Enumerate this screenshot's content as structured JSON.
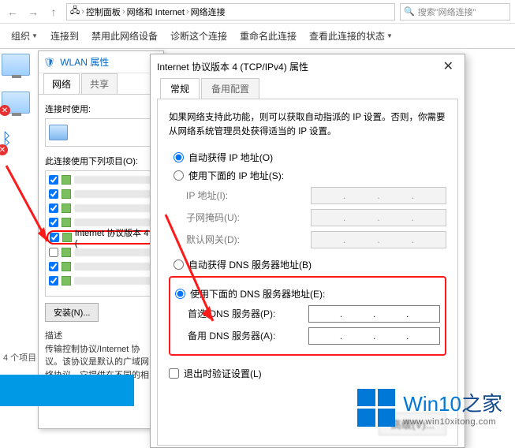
{
  "explorer": {
    "breadcrumb": [
      "",
      "控制面板",
      "网络和 Internet",
      "网络连接"
    ],
    "search_placeholder": "搜索\"网络连接\""
  },
  "commands": {
    "organize": "组织",
    "connect": "连接到",
    "disable": "禁用此网络设备",
    "diagnose": "诊断这个连接",
    "rename": "重命名此连接",
    "view_status": "查看此连接的状态"
  },
  "wlan_dialog": {
    "title": "WLAN 属性",
    "tabs": {
      "network": "网络",
      "share": "共享"
    },
    "connect_using": "连接时使用:",
    "items_label": "此连接使用下列项目(O):",
    "ipv4_item": "Internet 协议版本 4 (",
    "install_btn": "安装(N)...",
    "desc_title": "描述",
    "desc_text": "传输控制协议/Internet 协议。该协议是默认的广域网络协议，它提供在不同的相互连接的网络"
  },
  "ipv4_dialog": {
    "title": "Internet 协议版本 4 (TCP/IPv4) 属性",
    "tabs": {
      "general": "常规",
      "alt": "备用配置"
    },
    "description": "如果网络支持此功能，则可以获取自动指派的 IP 设置。否则，你需要从网络系统管理员处获得适当的 IP 设置。",
    "auto_ip": "自动获得 IP 地址(O)",
    "manual_ip": "使用下面的 IP 地址(S):",
    "ip_label": "IP 地址(I):",
    "mask_label": "子网掩码(U):",
    "gateway_label": "默认网关(D):",
    "auto_dns": "自动获得 DNS 服务器地址(B)",
    "manual_dns": "使用下面的 DNS 服务器地址(E):",
    "pref_dns": "首选 DNS 服务器(P):",
    "alt_dns": "备用 DNS 服务器(A):",
    "validate": "退出时验证设置(L)",
    "advanced": "高级(V)..."
  },
  "status": {
    "items_count": "4 个项目"
  },
  "watermark": {
    "brand1": "Win10",
    "brand2": "之家",
    "url": "www.win10xitong.com"
  }
}
